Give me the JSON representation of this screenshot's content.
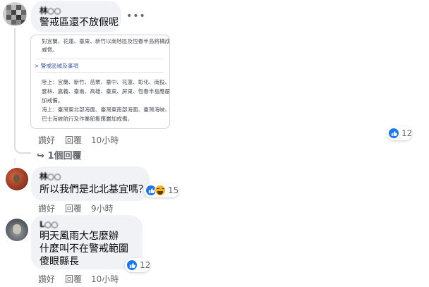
{
  "comments": [
    {
      "author": "林○○",
      "lines": [
        "警戒區還不放假呢"
      ],
      "more_icon": "more-horizontal-icon",
      "card": {
        "summary": [
          "對宜蘭、花蓮、臺東、新竹以南地區及恆春半島將構成",
          "威脅。"
        ],
        "link": "> 警戒區域及事項",
        "land": [
          "陸上：宜蘭、新竹、苗栗、臺中、花蓮、彰化、南投、",
          "雲林、嘉義、臺南、高雄、臺東、屏東、恆春半島應嚴",
          "加戒備。"
        ],
        "sea": [
          "海上：臺灣東北部海面、臺灣東南部海面、臺灣海峽、",
          "巴士海峽航行及作業船隻應嚴加戒備。"
        ]
      },
      "actions": {
        "like": "讚好",
        "reply": "回覆",
        "time": "10小時"
      },
      "reactions": {
        "icon": "like-icon",
        "count": "12"
      },
      "view_replies": "1個回覆"
    },
    {
      "author": "林○○",
      "lines": [
        "所以我們是北北基宜嗎？"
      ],
      "actions": {
        "like": "讚好",
        "reply": "回覆",
        "time": "9小時"
      },
      "reactions": {
        "icons": [
          "like-icon",
          "haha-icon"
        ],
        "count": "15"
      }
    },
    {
      "author": "L○○",
      "lines": [
        "明天風雨大怎麼辦",
        "什麼叫不在警戒範圍",
        "傻眼縣長"
      ],
      "actions": {
        "like": "讚好",
        "reply": "回覆",
        "time": "10小時"
      },
      "reactions": {
        "icon": "like-icon",
        "count": "12"
      }
    }
  ],
  "colors": {
    "bubble": "#f0f2f5",
    "secondary_text": "#65676b",
    "like_blue": "#1877f2",
    "link": "#385898"
  }
}
